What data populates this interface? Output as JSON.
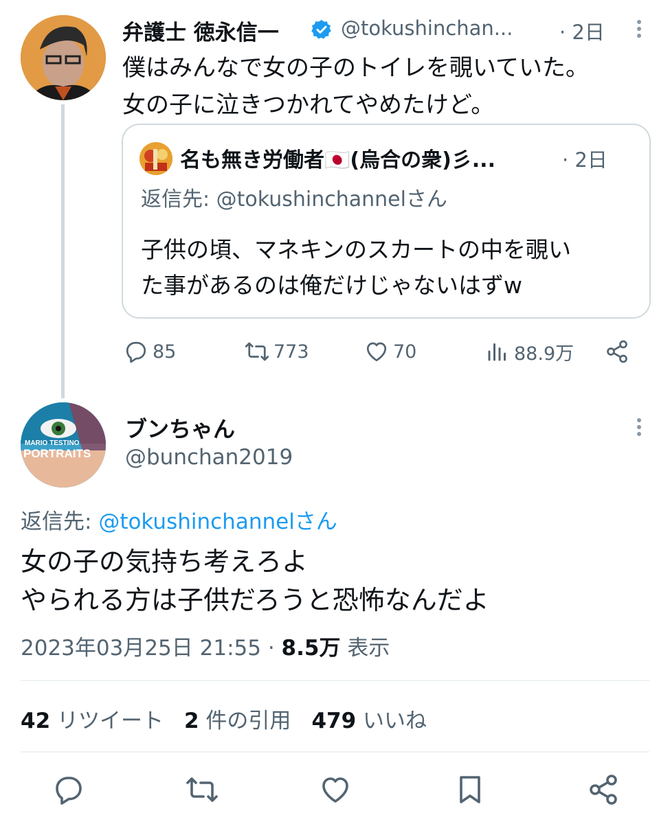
{
  "tweet1": {
    "author_name": "弁護士 徳永信一",
    "handle": "@tokushinchan...",
    "time": "· 2日",
    "body_lines": [
      "僕はみんなで女の子のトイレを覗いていた。",
      "女の子に泣きつかれてやめたけど。"
    ],
    "quote": {
      "author_name": "名も無き労働者🇯🇵(烏合の衆)彡...",
      "time": "· 2日",
      "reply_to": "返信先: @tokushinchannelさん",
      "body_lines": [
        "子供の頃、マネキンのスカートの中を覗い",
        "た事があるのは俺だけじゃないはずw"
      ]
    },
    "actions": {
      "replies": "85",
      "retweets": "773",
      "likes": "70",
      "views": "88.9万"
    }
  },
  "tweet2": {
    "author_name": "ブンちゃん",
    "handle": "@bunchan2019",
    "avatar_text": [
      "MARIO TESTINO",
      "PORTRAITS"
    ],
    "reply_prefix": "返信先: ",
    "reply_link": "@tokushinchannelさん",
    "body_lines": [
      "女の子の気持ち考えろよ",
      "やられる方は子供だろうと恐怖なんだよ"
    ],
    "timestamp": "2023年03月25日 21:55 · ",
    "views_count": "8.5万",
    "views_label": " 表示",
    "stats": {
      "retweets_count": "42",
      "retweets_label": " リツイート",
      "quotes_count": "2",
      "quotes_label": " 件の引用",
      "likes_count": "479",
      "likes_label": " いいね"
    }
  },
  "colors": {
    "text_primary": "#0f1419",
    "text_secondary": "#536471",
    "link": "#1d9bf0",
    "border": "#cfd9de"
  },
  "icons": [
    "verified-badge-icon",
    "more-icon",
    "reply-icon",
    "retweet-icon",
    "like-icon",
    "views-icon",
    "share-icon",
    "bookmark-icon"
  ]
}
